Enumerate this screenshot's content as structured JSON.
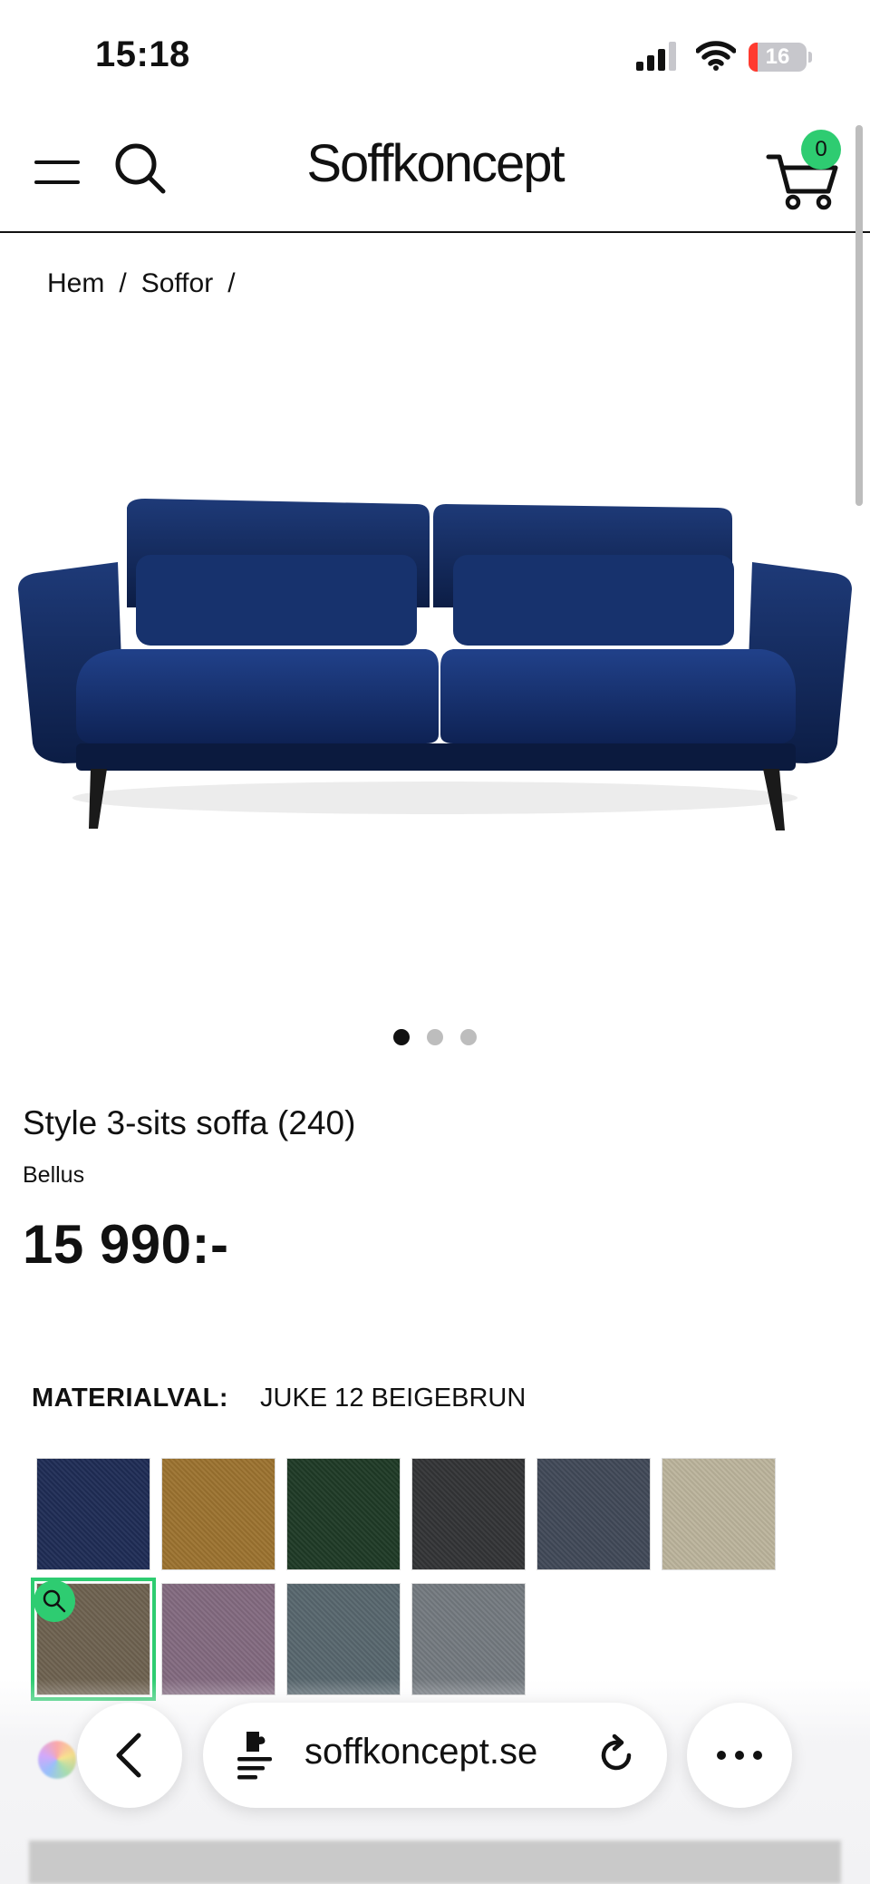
{
  "status_bar": {
    "time": "15:18",
    "battery_level": "16",
    "battery_fraction": 0.16,
    "icons": [
      "signal-icon",
      "wifi-icon",
      "battery-icon"
    ]
  },
  "header": {
    "logo": "Soffkoncept",
    "cart_count": "0",
    "icons": [
      "menu-icon",
      "search-icon",
      "cart-icon"
    ],
    "accent_color": "#2ecc71"
  },
  "breadcrumb": {
    "items": [
      "Hem",
      "Soffor"
    ],
    "separator": "/"
  },
  "gallery": {
    "image_count": 3,
    "active_index": 0
  },
  "product": {
    "title": "Style 3-sits soffa (240)",
    "brand": "Bellus",
    "price": "15 990:-"
  },
  "material": {
    "label": "MATERIALVAL:",
    "selected": "JUKE 12 BEIGEBRUN",
    "swatches": [
      {
        "color": "#1f2c55",
        "selected": false
      },
      {
        "color": "#9c7330",
        "selected": false
      },
      {
        "color": "#1f3a26",
        "selected": false
      },
      {
        "color": "#333436",
        "selected": false
      },
      {
        "color": "#414958",
        "selected": false
      },
      {
        "color": "#bcb49c",
        "selected": false
      },
      {
        "color": "#6e6250",
        "selected": true
      },
      {
        "color": "#836a80",
        "selected": false
      },
      {
        "color": "#58676e",
        "selected": false
      },
      {
        "color": "#747a80",
        "selected": false
      }
    ]
  },
  "browser": {
    "url": "soffkoncept.se",
    "icons": [
      "color-wheel-icon",
      "back-icon",
      "page-menu-icon",
      "reload-icon",
      "more-icon"
    ]
  }
}
